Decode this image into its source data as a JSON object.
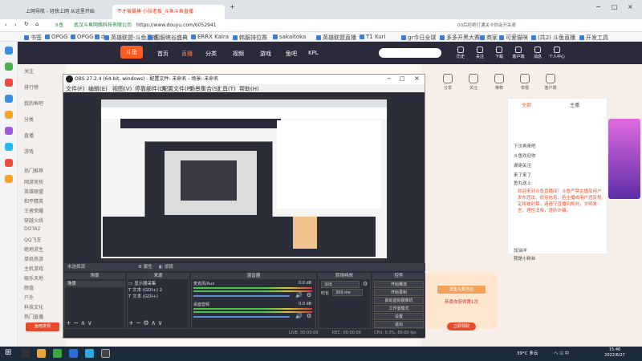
{
  "browser": {
    "tabs": [
      {
        "label": "上网导航 - 轻快上网 从这里开始",
        "active": false
      },
      {
        "label": "不才被暴揍·小张老板_斗鱼斗鱼直播",
        "active": true
      }
    ],
    "new_tab": "+",
    "security_label": "斗鱼",
    "url_host_prefix": "武汉斗鱼网络科技有限公司",
    "url": "https://www.douyu.com/6052941",
    "search_engine_hint": "00后拒绝打通关卡你会开关奇",
    "bookmarks": [
      "书签",
      "OPGG",
      "OPGG",
      "d",
      "英雄联盟-斗鱼直播",
      "国服峡谷盛典",
      "ERRX Kaira",
      "韩服排位赛",
      "sakaitoka",
      "英雄联盟直播",
      "T1 Kuri",
      "gr今日全球",
      "多多开黑大赛",
      "商家",
      "可爱猫咪",
      "(共2) 斗鱼直播",
      "开发工具"
    ]
  },
  "douyu": {
    "logo": "斗鱼",
    "nav": [
      "首页",
      "直播",
      "分类",
      "视频",
      "游戏",
      "鱼吧",
      "KPL"
    ],
    "header_icons": [
      "历史",
      "关注",
      "下载",
      "客户端",
      "消息",
      "个人中心"
    ],
    "leftnav": [
      "关注",
      "排行榜",
      "我的鱼吧",
      "分类",
      "直播",
      "游戏",
      "热门推荐",
      "网游竞技",
      "英雄联盟",
      "和平精英",
      "王者荣耀",
      "穿越火线",
      "DOTA2",
      "QQ飞车",
      "绝地求生",
      "单机热游",
      "主机游戏",
      "娱乐天地",
      "颜值",
      "户外",
      "科技文化",
      "热门直播"
    ],
    "leftnav_banner": "鱼吧发现",
    "room_icons": [
      "分享",
      "关注",
      "推荐",
      "举报",
      "客户端"
    ],
    "rpanel_list": [
      "全部",
      "主播"
    ],
    "chat_lines": [
      "下次再来吧",
      "斗鱼欢迎你",
      "谢谢关注",
      "来了来了",
      "鱼丸送上",
      "加油冲",
      "我是小粉丝"
    ],
    "notice": "欢迎来到斗鱼直播间！斗鱼严禁主播及用户发布违法、低俗信息，若主播或用户违反规定将被封禁。请遵守直播间规则，文明发言，理性消费，谨防诈骗。",
    "promo": {
      "title": "送鱼丸集活动",
      "body": "恭喜你获得第1次",
      "button": "立即领取"
    }
  },
  "obs": {
    "title": "OBS 27.2.4 (64-bit, windows) - 配置文件: 未命名 - 场景: 未命名",
    "menu": [
      "文件(F)",
      "编辑(E)",
      "视图(V)",
      "停靠部件(D)",
      "配置文件(P)",
      "场景集合(S)",
      "工具(T)",
      "帮助(H)"
    ],
    "source_label": "未选择源",
    "toolbar_props": "属性",
    "toolbar_filters": "滤镜",
    "docks": [
      "场景",
      "来源",
      "混音器",
      "转场特效",
      "控件"
    ],
    "scenes": [
      "场景"
    ],
    "sources": [
      "显示器采集",
      "文本 (GDI+) 2",
      "文本 (GDI+)"
    ],
    "mixer": [
      {
        "name": "麦克风/Aux",
        "db": "0.0 dB"
      },
      {
        "name": "桌面音频",
        "db": "0.0 dB"
      }
    ],
    "transition": {
      "type": "淡出",
      "duration_label": "时长",
      "duration": "300 ms"
    },
    "controls": [
      "开始推流",
      "开始录制",
      "启动虚拟摄像机",
      "工作室模式",
      "设置",
      "退出"
    ],
    "status": {
      "live": "LIVE: 00:00:00",
      "rec": "REC: 00:00:00",
      "cpu": "CPU: 0.3%, 60.00 fps"
    }
  },
  "taskbar": {
    "weather": "39°C 多云",
    "tray": "ヘ ⊡ 中",
    "time": "15:46",
    "date": "2022/6/27"
  }
}
